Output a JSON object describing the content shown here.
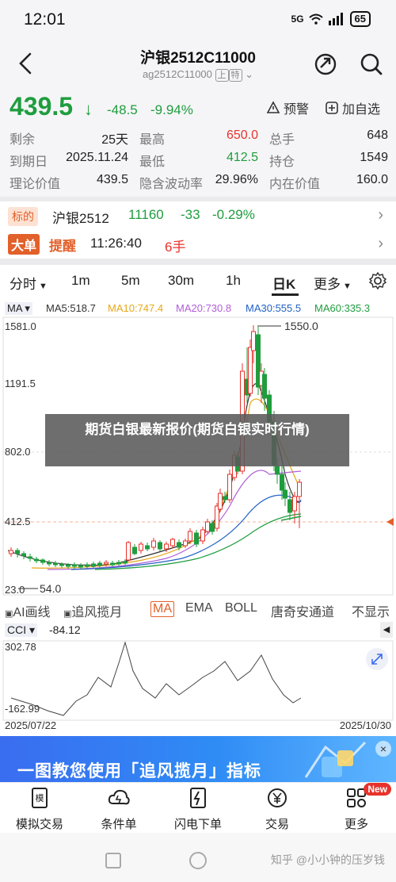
{
  "status": {
    "time": "12:01",
    "network": "5G",
    "battery": "65"
  },
  "header": {
    "title": "沪银2512C11000",
    "code": "ag2512C11000",
    "exchange_badge": "上",
    "type_badge": "特"
  },
  "quote": {
    "price": "439.5",
    "change": "-48.5",
    "change_pct": "-9.94%",
    "alert_label": "预警",
    "watch_label": "加自选"
  },
  "stats": {
    "rows": [
      [
        {
          "label": "剩余",
          "value": "25天"
        },
        {
          "label": "最高",
          "value": "650.0"
        },
        {
          "label": "总手",
          "value": "648"
        }
      ],
      [
        {
          "label": "到期日",
          "value": "2025.11.24"
        },
        {
          "label": "最低",
          "value": "412.5"
        },
        {
          "label": "持仓",
          "value": "1549"
        }
      ],
      [
        {
          "label": "理论价值",
          "value": "439.5"
        },
        {
          "label": "隐含波动率",
          "value": "29.96%"
        },
        {
          "label": "内在价值",
          "value": "160.0"
        }
      ]
    ]
  },
  "underlying": {
    "tag": "标的",
    "name": "沪银2512",
    "price": "11160",
    "change": "-33",
    "change_pct": "-0.29%"
  },
  "bigorder": {
    "tag": "大单",
    "label": "提醒",
    "time": "11:26:40",
    "qty": "6手"
  },
  "periods": [
    "分时",
    "1m",
    "5m",
    "30m",
    "1h",
    "日K",
    "更多"
  ],
  "ma": {
    "selector": "MA",
    "items": [
      {
        "text": "MA5:518.7",
        "color": "#333333"
      },
      {
        "text": "MA10:747.4",
        "color": "#e6a817"
      },
      {
        "text": "MA20:730.8",
        "color": "#b05fd6"
      },
      {
        "text": "MA30:555.5",
        "color": "#2262c6"
      },
      {
        "text": "MA60:335.3",
        "color": "#1f9d3e"
      }
    ]
  },
  "kchart": {
    "yticks": [
      "1581.0",
      "1191.5",
      "802.0",
      "412.5",
      "23.0"
    ],
    "high_label": "1550.0",
    "low_label": "54.0"
  },
  "overlay": {
    "text": "期货白银最新报价(期货白银实时行情)"
  },
  "indicator_tabs": [
    "AI画线",
    "追风揽月",
    "MA",
    "EMA",
    "BOLL",
    "唐奇安通道",
    "不显示"
  ],
  "cci": {
    "label": "CCI",
    "value": "-84.12",
    "ymax": "302.78",
    "ymin": "-162.99"
  },
  "dates": {
    "start": "2025/07/22",
    "end": "2025/10/30"
  },
  "ad": {
    "text": "一图教您使用「追风揽月」指标"
  },
  "bottom_nav": [
    {
      "label": "模拟交易",
      "icon": "sim-trade-icon"
    },
    {
      "label": "条件单",
      "icon": "cloud-order-icon"
    },
    {
      "label": "闪电下单",
      "icon": "flash-order-icon"
    },
    {
      "label": "交易",
      "icon": "yen-coin-icon"
    },
    {
      "label": "更多",
      "icon": "grid-more-icon",
      "badge": "New"
    }
  ],
  "watermark": "知乎 @小小钟的压岁钱",
  "colors": {
    "down": "#1f9d3e",
    "up": "#e8322b",
    "accent": "#e2602a"
  }
}
